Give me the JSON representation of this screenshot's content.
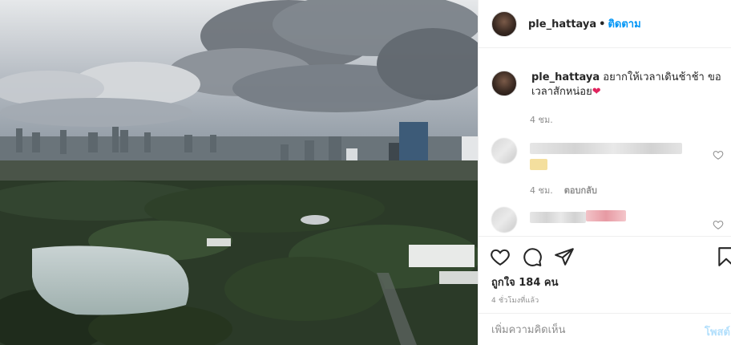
{
  "photo": {
    "alt_subject": "city-park-skyline"
  },
  "header": {
    "username": "ple_hattaya",
    "separator": "•",
    "follow_label": "ติดตาม"
  },
  "caption": {
    "username": "ple_hattaya",
    "text": "อยากให้เวลาเดินช้าช้า ขอเวลาสักหน่อย",
    "emoji": "❤",
    "time": "4 ชม."
  },
  "comments": [
    {
      "time": "4 ชม.",
      "reply_label": "ตอบกลับ",
      "blurred": true
    },
    {
      "blurred": true
    }
  ],
  "actions": {
    "like_icon": "heart-icon",
    "comment_icon": "comment-icon",
    "share_icon": "send-icon",
    "save_icon": "bookmark-icon"
  },
  "likes": {
    "text": "ถูกใจ 184 คน"
  },
  "posted": {
    "text": "4 ชั่วโมงที่แล้ว"
  },
  "add_comment": {
    "placeholder": "เพิ่มความคิดเห็น",
    "post_label": "โพสต์"
  },
  "colors": {
    "link_blue": "#0095f6",
    "post_disabled": "#b2dffc",
    "muted": "#8e8e8e",
    "heart_red": "#e0245e"
  }
}
